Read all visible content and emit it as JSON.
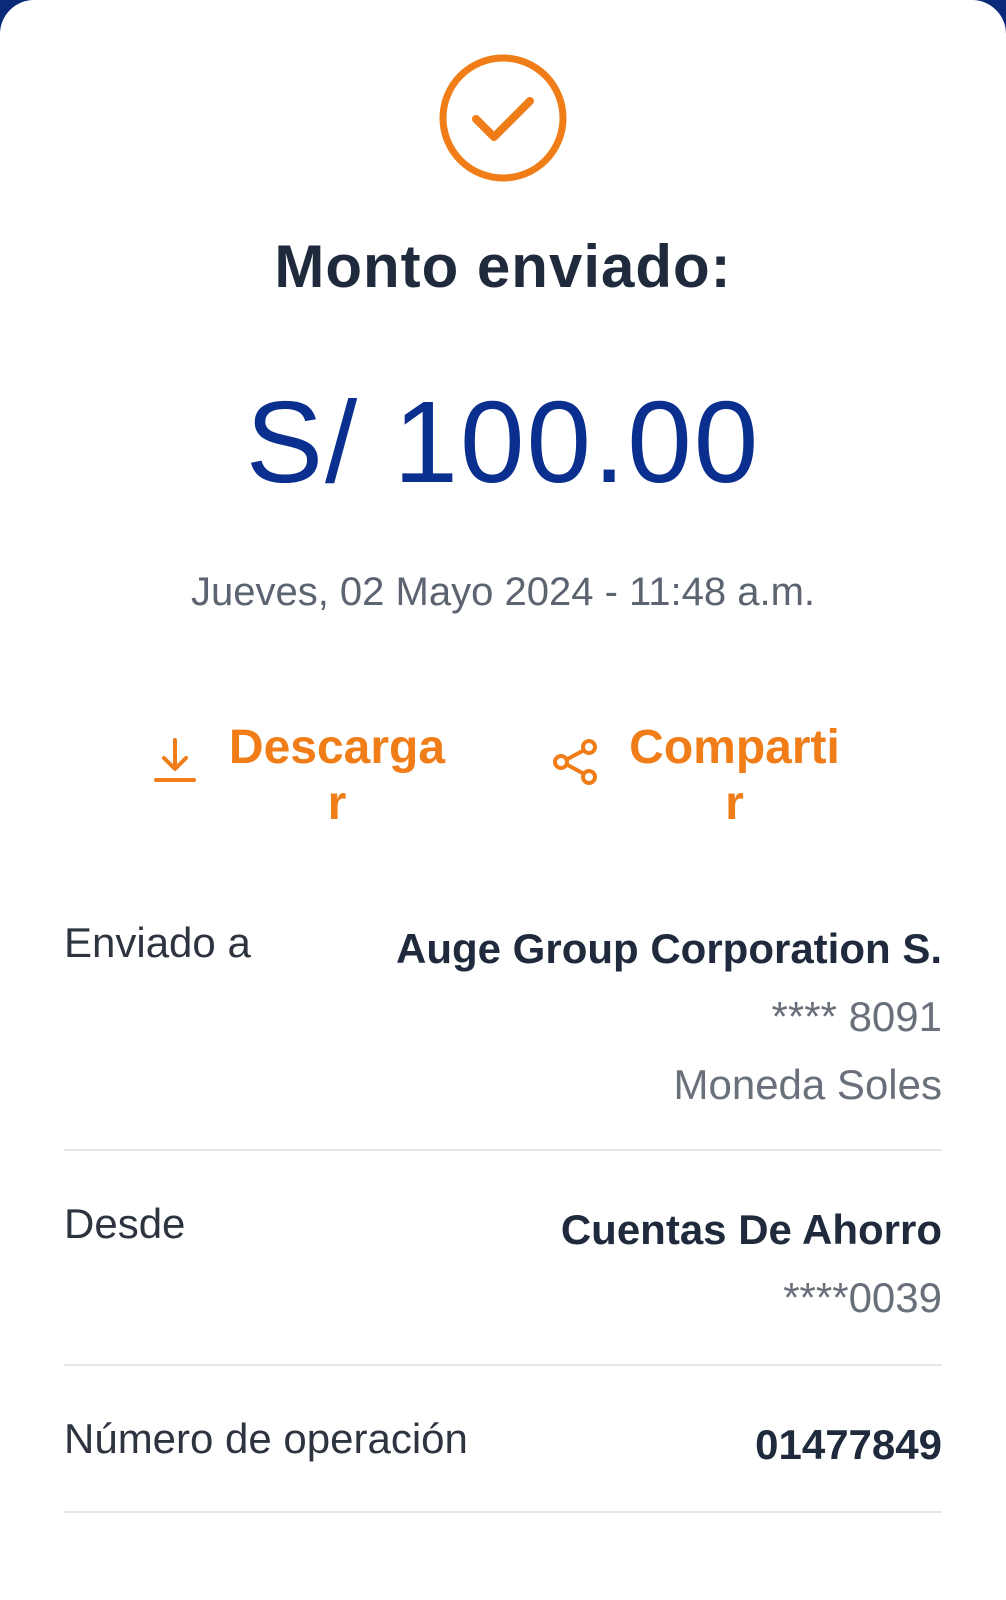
{
  "colors": {
    "accent_orange": "#f07d17",
    "amount_blue": "#0a2f8f",
    "title_dark": "#1f2a3d",
    "muted_gray": "#6a707b"
  },
  "status": {
    "icon": "check-circle-icon",
    "title": "Monto enviado:"
  },
  "amount": "S/ 100.00",
  "datetime": "Jueves, 02 Mayo 2024 - 11:48 a.m.",
  "actions": {
    "download": {
      "icon": "download-icon",
      "label": "Descargar"
    },
    "share": {
      "icon": "share-icon",
      "label": "Compartir"
    }
  },
  "details": {
    "recipient": {
      "label": "Enviado a",
      "name": "Auge Group Corporation S.",
      "account": "**** 8091",
      "currency": "Moneda Soles"
    },
    "source": {
      "label": "Desde",
      "account_type": "Cuentas De Ahorro",
      "account": "****0039"
    },
    "operation": {
      "label": "Número de operación",
      "number": "01477849"
    }
  }
}
